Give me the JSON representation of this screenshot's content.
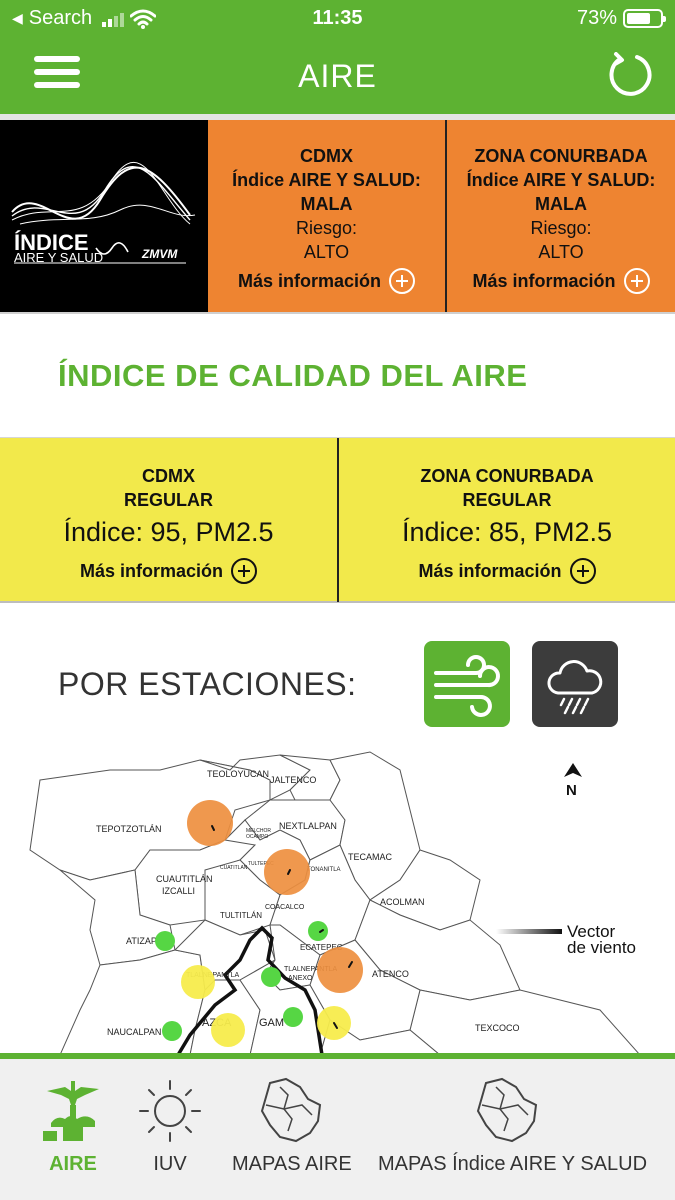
{
  "status_bar": {
    "back_label": "Search",
    "time": "11:35",
    "battery_percent": "73%",
    "battery_level": 0.73
  },
  "app_bar": {
    "title": "AIRE"
  },
  "aire_salud": {
    "logo": {
      "line1": "ÍNDICE",
      "line2": "AIRE Y SALUD",
      "line3": "ZMVM"
    },
    "cards": [
      {
        "region": "CDMX",
        "label": "Índice AIRE Y SALUD:",
        "status": "MALA",
        "risk_label": "Riesgo:",
        "risk": "ALTO",
        "more": "Más información"
      },
      {
        "region": "ZONA CONURBADA",
        "label": "Índice AIRE Y SALUD:",
        "status": "MALA",
        "risk_label": "Riesgo:",
        "risk": "ALTO",
        "more": "Más información"
      }
    ],
    "color": "#ee8431"
  },
  "calidad": {
    "title": "ÍNDICE DE CALIDAD DEL AIRE",
    "cards": [
      {
        "region": "CDMX",
        "status": "REGULAR",
        "index": "Índice: 95, PM2.5",
        "more": "Más información"
      },
      {
        "region": "ZONA CONURBADA",
        "status": "REGULAR",
        "index": "Índice: 85, PM2.5",
        "more": "Más información"
      }
    ],
    "color": "#f2e94b"
  },
  "estaciones": {
    "label": "POR ESTACIONES:",
    "wind_button_icon": "wind-icon",
    "rain_button_icon": "rain-cloud-icon"
  },
  "map": {
    "north": "N",
    "legend_line1": "Vector",
    "legend_line2": "de viento",
    "municipalities": {
      "teoloyucan": "TEOLOYUCAN",
      "jaltenco": "JALTENCO",
      "tepotzotlan": "TEPOTZOTLÁN",
      "nextlalpan": "NEXTLALPAN",
      "melchor": "MELCHOR",
      "ocampo": "OCAMPO",
      "tecamac": "TECAMAC",
      "cuautitlan_izcalli_1": "CUAUTITLÁN",
      "cuautitlan_izcalli_2": "IZCALLI",
      "cuautitlan": "CUATITLAN",
      "tultepec": "TULTEPEC",
      "tonanitla": "TONANITLA",
      "acolman": "ACOLMAN",
      "coacalco": "COACALCO",
      "tultitlan": "TULTITLÁN",
      "atizapan": "ATIZAPÁN",
      "ecatepec": "ECATEPEC",
      "tlalnepantla": "TLALNEPANTLA",
      "tlalnepantla_anexo_1": "TLALNEPANTLA",
      "tlalnepantla_anexo_2": "ANEXO",
      "atenco": "ATENCO",
      "texcoco": "TEXCOCO",
      "naucalpan": "NAUCALPAN",
      "azca": "AZCA",
      "gam": "GAM"
    },
    "station_colors": {
      "orange": "#ee8f3f",
      "yellow": "#f7ec4c",
      "green": "#56d644"
    }
  },
  "tabs": [
    {
      "label": "AIRE",
      "icon": "angel-monument-icon",
      "active": true
    },
    {
      "label": "IUV",
      "icon": "sun-icon",
      "active": false
    },
    {
      "label": "MAPAS AIRE",
      "icon": "map-outline-icon",
      "active": false
    },
    {
      "label": "MAPAS Índice AIRE Y SALUD",
      "icon": "map-outline-icon",
      "active": false
    }
  ]
}
